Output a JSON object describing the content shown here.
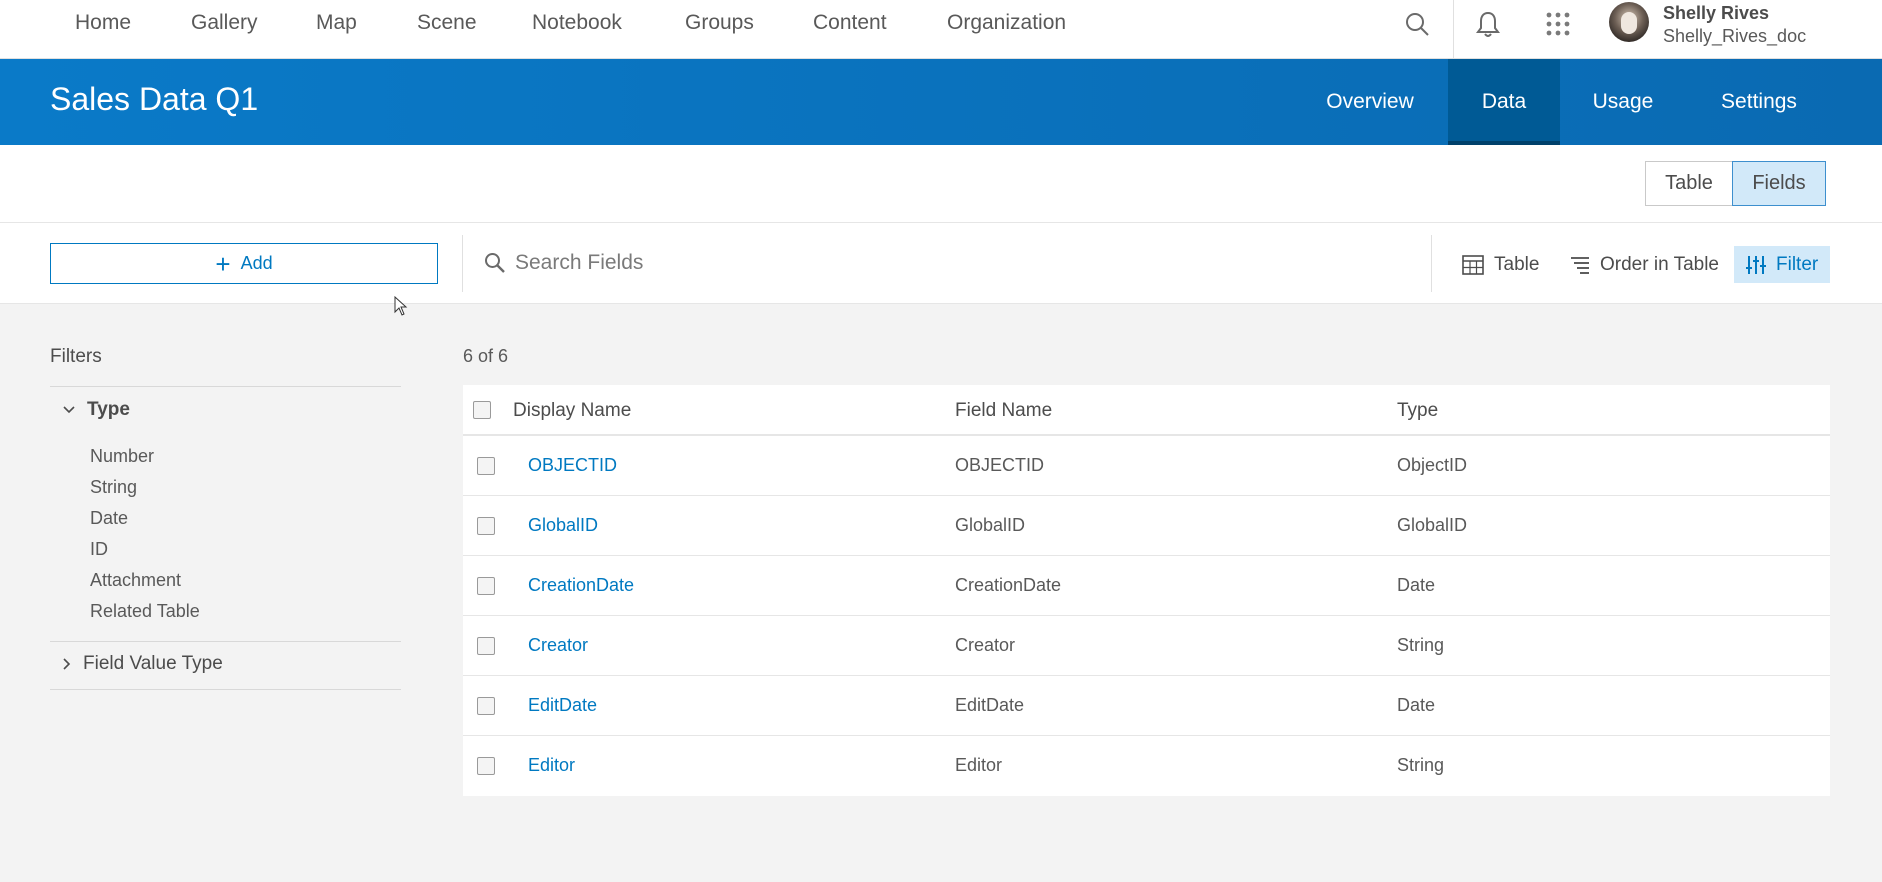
{
  "topnav": {
    "links": [
      "Home",
      "Gallery",
      "Map",
      "Scene",
      "Notebook",
      "Groups",
      "Content",
      "Organization"
    ],
    "icons": [
      "search-icon",
      "bell-icon",
      "apps-grid-icon"
    ],
    "user": {
      "name": "Shelly Rives",
      "username": "Shelly_Rives_doc"
    }
  },
  "header": {
    "title": "Sales Data Q1",
    "tabs": [
      "Overview",
      "Data",
      "Usage",
      "Settings"
    ],
    "active_tab": "Data"
  },
  "view_toggle": {
    "options": [
      "Table",
      "Fields"
    ],
    "active": "Fields"
  },
  "toolbar": {
    "add_label": "Add",
    "search_placeholder": "Search Fields",
    "table_label": "Table",
    "order_label": "Order in Table",
    "filter_label": "Filter"
  },
  "filters": {
    "title": "Filters",
    "type_group": {
      "label": "Type",
      "options": [
        "Number",
        "String",
        "Date",
        "ID",
        "Attachment",
        "Related Table"
      ]
    },
    "field_value_group": {
      "label": "Field Value Type"
    }
  },
  "table": {
    "count": "6 of 6",
    "headers": [
      "Display Name",
      "Field Name",
      "Type"
    ],
    "rows": [
      {
        "display": "OBJECTID",
        "field": "OBJECTID",
        "type": "ObjectID"
      },
      {
        "display": "GlobalID",
        "field": "GlobalID",
        "type": "GlobalID"
      },
      {
        "display": "CreationDate",
        "field": "CreationDate",
        "type": "Date"
      },
      {
        "display": "Creator",
        "field": "Creator",
        "type": "String"
      },
      {
        "display": "EditDate",
        "field": "EditDate",
        "type": "Date"
      },
      {
        "display": "Editor",
        "field": "Editor",
        "type": "String"
      }
    ]
  },
  "colors": {
    "accent": "#0079c1",
    "header_bg": "#0a6ab2",
    "active_tab_bg": "#005a95",
    "selected_bg": "#d2e9f9"
  }
}
